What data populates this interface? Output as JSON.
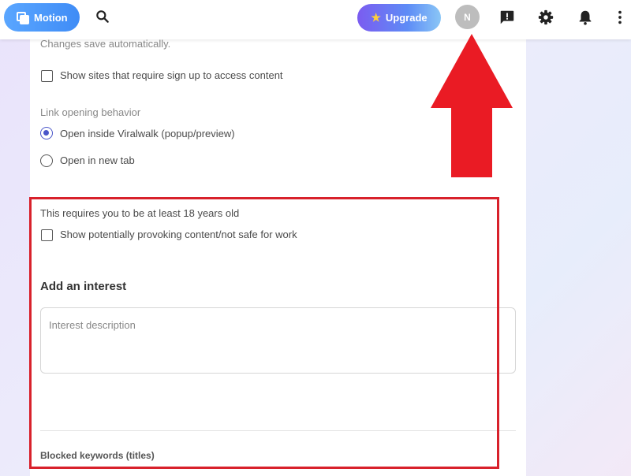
{
  "header": {
    "motion_label": "Motion",
    "upgrade_label": "Upgrade",
    "avatar_initial": "N",
    "icons": [
      "search-icon",
      "feedback-icon",
      "gear-icon",
      "bell-icon",
      "more-vert-icon"
    ]
  },
  "settings": {
    "changes_note": "Changes save automatically.",
    "signup_checkbox_label": "Show sites that require sign up to access content",
    "signup_checked": false,
    "link_behavior_title": "Link opening behavior",
    "link_options": [
      {
        "label": "Open inside Viralwalk (popup/preview)",
        "selected": true
      },
      {
        "label": "Open in new tab",
        "selected": false
      }
    ],
    "age_note": "This requires you to be at least 18 years old",
    "nsfw_checkbox_label": "Show potentially provoking content/not safe for work",
    "nsfw_checked": false,
    "add_interest_heading": "Add an interest",
    "interest_placeholder": "Interest description",
    "blocked_keywords_heading": "Blocked keywords (titles)"
  },
  "colors": {
    "accent": "#4a56c9",
    "annotation_red": "#d8212b",
    "motion_blue": "#3f8cf6",
    "upgrade_purple": "#7b5cf0"
  }
}
